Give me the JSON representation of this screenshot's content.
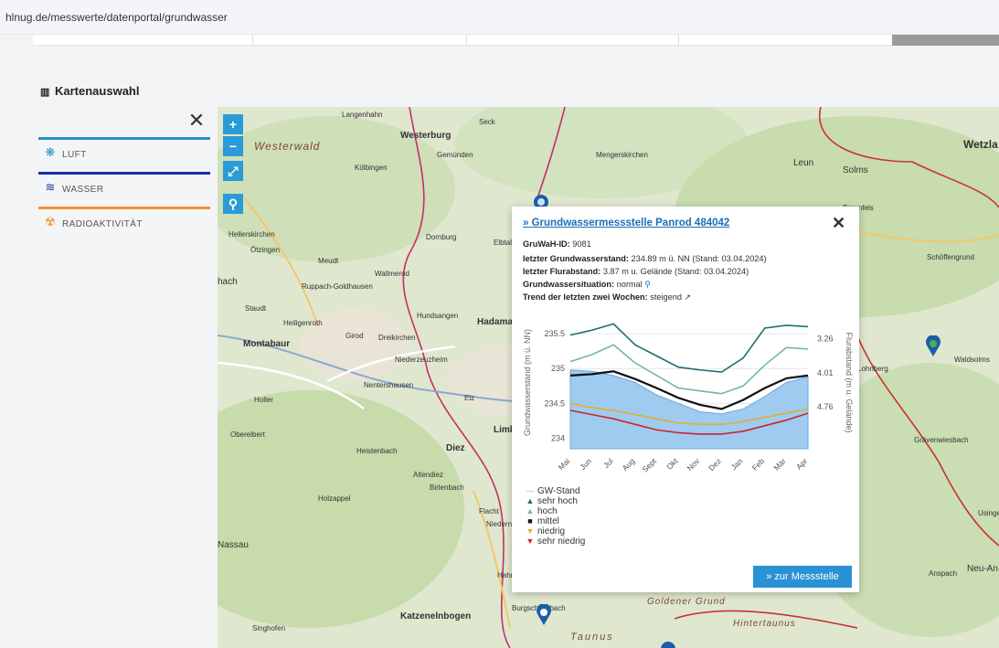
{
  "browser": {
    "url": "hlnug.de/messwerte/datenportal/grundwasser"
  },
  "section": {
    "title": "Kartenauswahl",
    "icon": "map-icon"
  },
  "sidebar": {
    "close_label": "✕",
    "items": [
      {
        "label": "LUFT",
        "color": "#2a8fd0",
        "icon": "snowflake-icon"
      },
      {
        "label": "WASSER",
        "color": "#1a2fa8",
        "icon": "waves-icon"
      },
      {
        "label": "RADIOAKTIVITÄT",
        "color": "#f2922a",
        "icon": "radiation-icon"
      }
    ]
  },
  "map": {
    "controls": {
      "zoom_in": "+",
      "zoom_out": "−",
      "fullscreen": "⤢",
      "search": "⚲"
    },
    "labels": [
      "Westerwald",
      "Westerburg",
      "Langenhahn",
      "Seck",
      "Gemünden",
      "Kölbingen",
      "Mengerskirchen",
      "Leun",
      "Solms",
      "Wetzla",
      "Braunfels",
      "Hellerskirchen",
      "Ötzingen",
      "Meudt",
      "Wallmerod",
      "Dornburg",
      "Elbtal",
      "Ruppach-Goldhausen",
      "Staudt",
      "Heiligenroth",
      "Girod",
      "Montabaur",
      "Dreikirchen",
      "Niederzeuzheim",
      "Hundsangen",
      "Hadamar",
      "Nentershausen",
      "Holler",
      "Oberelbert",
      "Heistenbach",
      "Diez",
      "Limburg",
      "Altendiez",
      "Birlenbach",
      "Holzappel",
      "Flacht",
      "Niederneisen",
      "Nassau",
      "Hahnstätten",
      "Burgschwalbach",
      "Singhofen",
      "Katzenelnbogen",
      "Taunus",
      "Goldener Grund",
      "Hintertaunus",
      "Schöffengrund",
      "Waldsolms",
      "Grävenwiesbach",
      "Neu-An",
      "Anspach",
      "Usingen",
      "Elz",
      "hach",
      "Lohnberg"
    ],
    "zoom_level": ""
  },
  "popup": {
    "title": "Grundwassermessstelle Panrod 484042",
    "title_prefix": "»",
    "close_label": "✕",
    "gruwah_label": "GruWaH-ID:",
    "gruwah_value": "9081",
    "gw_label": "letzter Grundwasserstand:",
    "gw_value": "234.89 m ü. NN (Stand: 03.04.2024)",
    "flur_label": "letzter Flurabstand:",
    "flur_value": "3.87 m u. Gelände (Stand: 03.04.2024)",
    "situation_label": "Grundwassersituation:",
    "situation_value": "normal",
    "trend_label": "Trend der letzten zwei Wochen:",
    "trend_value": "steigend",
    "button_label": "» zur Messstelle"
  },
  "chart_data": {
    "type": "line",
    "ylabel": "Grundwasserstand (m ü. NN)",
    "y2label": "Flurabstand (m u. Gelände)",
    "categories": [
      "Mai",
      "Jun",
      "Jul",
      "Aug",
      "Sept",
      "Okt",
      "Nov",
      "Dez",
      "Jan",
      "Feb",
      "Mär",
      "Apr"
    ],
    "yticks": [
      "235.5",
      "235",
      "234.5",
      "234"
    ],
    "y2ticks": [
      "3.26",
      "4.01",
      "4.76"
    ],
    "ylim": [
      233.85,
      235.75
    ],
    "series": [
      {
        "name": "GW-Stand",
        "color": "#7fb6e6",
        "values": [
          234.98,
          234.96,
          234.9,
          234.8,
          234.62,
          234.5,
          234.38,
          234.35,
          234.42,
          234.6,
          234.8,
          234.88
        ]
      },
      {
        "name": "sehr hoch",
        "color": "#1f6f6f",
        "values": [
          235.48,
          235.55,
          235.64,
          235.34,
          235.18,
          235.02,
          234.98,
          234.95,
          235.15,
          235.58,
          235.62,
          235.6
        ]
      },
      {
        "name": "hoch",
        "color": "#6fb5b0",
        "values": [
          235.1,
          235.2,
          235.34,
          235.08,
          234.9,
          234.72,
          234.68,
          234.64,
          234.75,
          235.05,
          235.3,
          235.28
        ]
      },
      {
        "name": "mittel",
        "color": "#111111",
        "values": [
          234.9,
          234.92,
          234.96,
          234.85,
          234.72,
          234.58,
          234.48,
          234.42,
          234.55,
          234.72,
          234.86,
          234.9
        ]
      },
      {
        "name": "niedrig",
        "color": "#e0b12a",
        "values": [
          234.5,
          234.44,
          234.4,
          234.34,
          234.28,
          234.22,
          234.2,
          234.2,
          234.24,
          234.3,
          234.36,
          234.42
        ]
      },
      {
        "name": "sehr niedrig",
        "color": "#c9262a",
        "values": [
          234.4,
          234.34,
          234.28,
          234.2,
          234.12,
          234.08,
          234.06,
          234.06,
          234.1,
          234.18,
          234.26,
          234.36
        ]
      }
    ],
    "legend": [
      "GW-Stand",
      "sehr hoch",
      "hoch",
      "mittel",
      "niedrig",
      "sehr niedrig"
    ]
  }
}
